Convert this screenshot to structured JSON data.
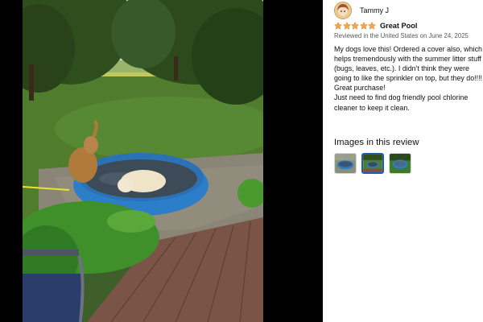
{
  "review": {
    "reviewer_name": "Tammy J",
    "rating": 5,
    "title": "Great Pool",
    "meta": "Reviewed in the United States on June 24, 2025",
    "body": [
      "My dogs love this! Ordered a cover also, which helps tremendously with the summer litter stuff (bugs, leaves, etc.). I didn't think they were going to like the sprinkler on top, but they do!!!! Great purchase!",
      "Just need to find dog friendly pool chlorine cleaner to keep it clean."
    ]
  },
  "images_section": {
    "heading": "Images in this review",
    "selected_index": 1,
    "thumbnail_count": 3
  },
  "colors": {
    "star": "#f3a847",
    "pool": "#2d7ec8",
    "selected_border": "#1f5fa8"
  },
  "icons": [
    "avatar",
    "star-icon",
    "photo-thumbnail"
  ]
}
